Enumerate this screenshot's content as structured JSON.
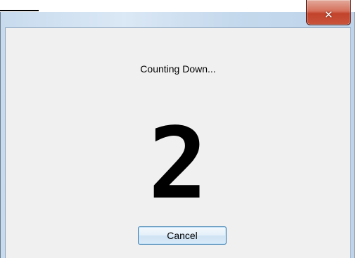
{
  "window": {
    "close_icon": "close-icon"
  },
  "dialog": {
    "status_text": "Counting Down...",
    "countdown_value": "2",
    "cancel_label": "Cancel"
  },
  "colors": {
    "close_button": "#c9533b",
    "button_border": "#3c7fb1",
    "client_background": "#f0f0f0"
  }
}
